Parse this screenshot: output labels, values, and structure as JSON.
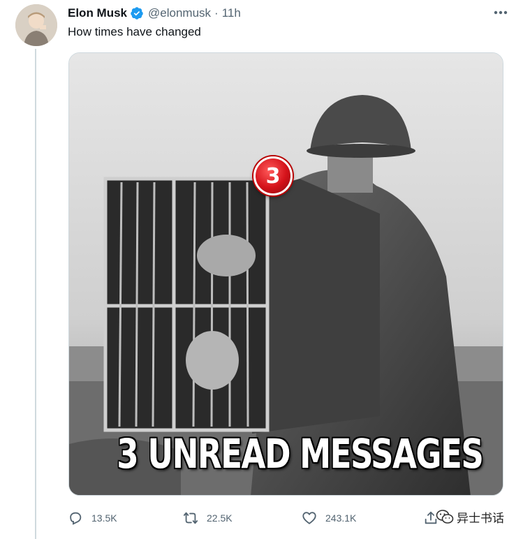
{
  "tweet": {
    "author": {
      "name": "Elon Musk",
      "handle": "@elonmusk",
      "verified": true
    },
    "separator": "·",
    "time": "11h",
    "text": "How times have changed",
    "media": {
      "caption": "3 UNREAD MESSAGES",
      "badge_count": "3"
    },
    "actions": {
      "reply": {
        "icon": "reply-icon",
        "count": "13.5K"
      },
      "retweet": {
        "icon": "retweet-icon",
        "count": "22.5K"
      },
      "like": {
        "icon": "heart-icon",
        "count": "243.1K"
      },
      "share": {
        "icon": "share-icon"
      }
    }
  },
  "watermark": {
    "icon": "wechat-icon",
    "text": "异士书话"
  },
  "colors": {
    "verified": "#1d9bf0",
    "secondary_text": "#536471",
    "primary_text": "#0f1419",
    "border": "#cfd9de"
  }
}
